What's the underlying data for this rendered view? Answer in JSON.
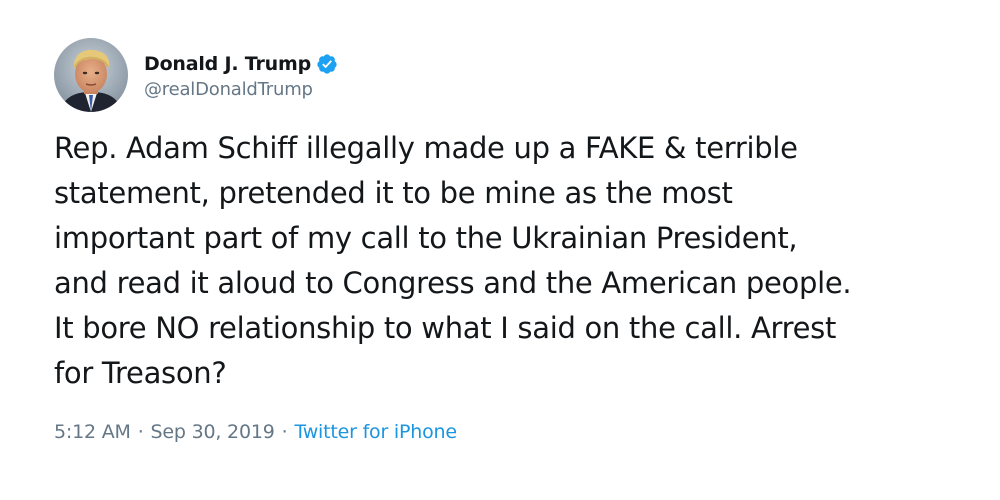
{
  "author": {
    "display_name": "Donald J. Trump",
    "handle": "@realDonaldTrump",
    "verified": true,
    "verified_color": "#1da1f2"
  },
  "tweet": {
    "text_lines": [
      "Rep. Adam Schiff illegally made up a FAKE & terrible",
      "statement, pretended it to be mine as the most",
      "important part of my call to the Ukrainian President,",
      "and read it aloud to Congress and the American people.",
      "It bore NO relationship to what I said on the call. Arrest",
      "for Treason?"
    ]
  },
  "meta": {
    "time": "5:12 AM",
    "separator": "·",
    "date": "Sep 30, 2019",
    "source": "Twitter for iPhone",
    "source_color": "#1b95e0",
    "muted_color": "#657786"
  }
}
